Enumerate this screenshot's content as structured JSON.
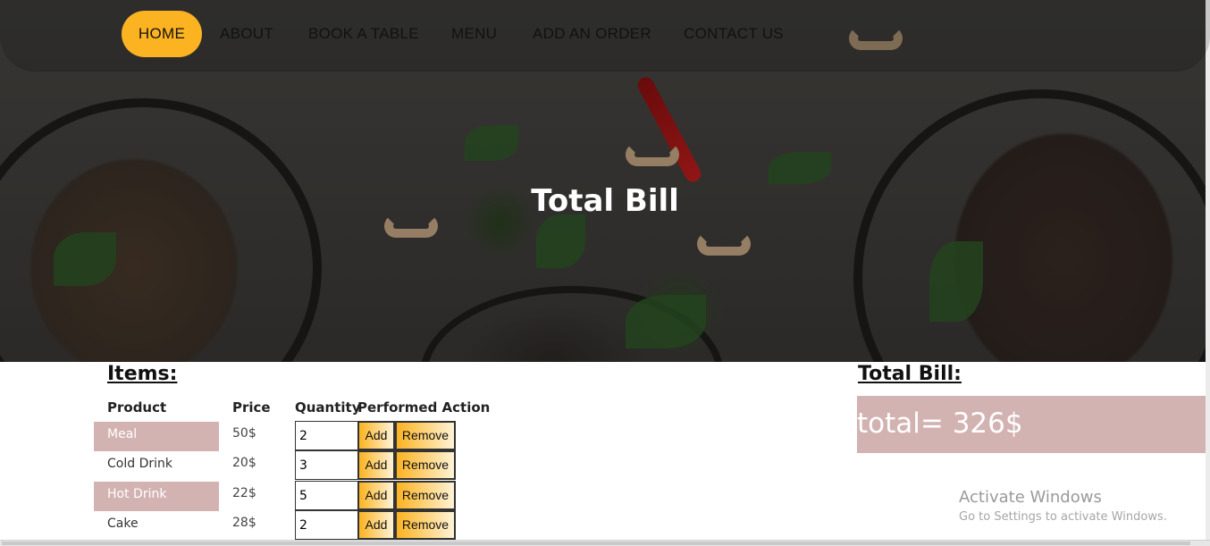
{
  "nav": {
    "items": [
      {
        "label": "HOME",
        "active": true
      },
      {
        "label": "ABOUT"
      },
      {
        "label": "BOOK A TABLE"
      },
      {
        "label": "MENU"
      },
      {
        "label": "ADD AN ORDER"
      },
      {
        "label": "CONTACT US"
      }
    ],
    "accent_color": "#fbb321"
  },
  "hero": {
    "title": "Total Bill"
  },
  "items_section": {
    "title": "Items:",
    "headers": {
      "product": "Product",
      "price": "Price",
      "quantity": "Quantity",
      "action": "Performed Action"
    },
    "rows": [
      {
        "product": "Meal",
        "price": "50$",
        "quantity": "2",
        "highlighted": true
      },
      {
        "product": "Cold Drink",
        "price": "20$",
        "quantity": "3",
        "highlighted": false
      },
      {
        "product": "Hot Drink",
        "price": "22$",
        "quantity": "5",
        "highlighted": true
      },
      {
        "product": "Cake",
        "price": "28$",
        "quantity": "2",
        "highlighted": false
      }
    ],
    "add_label": "Add",
    "remove_label": "Remove",
    "highlight_color": "#d3b2b2"
  },
  "total_section": {
    "title": "Total Bill:",
    "total_text": "total= 326$"
  },
  "watermark": {
    "title": "Activate Windows",
    "subtitle": "Go to Settings to activate Windows."
  }
}
